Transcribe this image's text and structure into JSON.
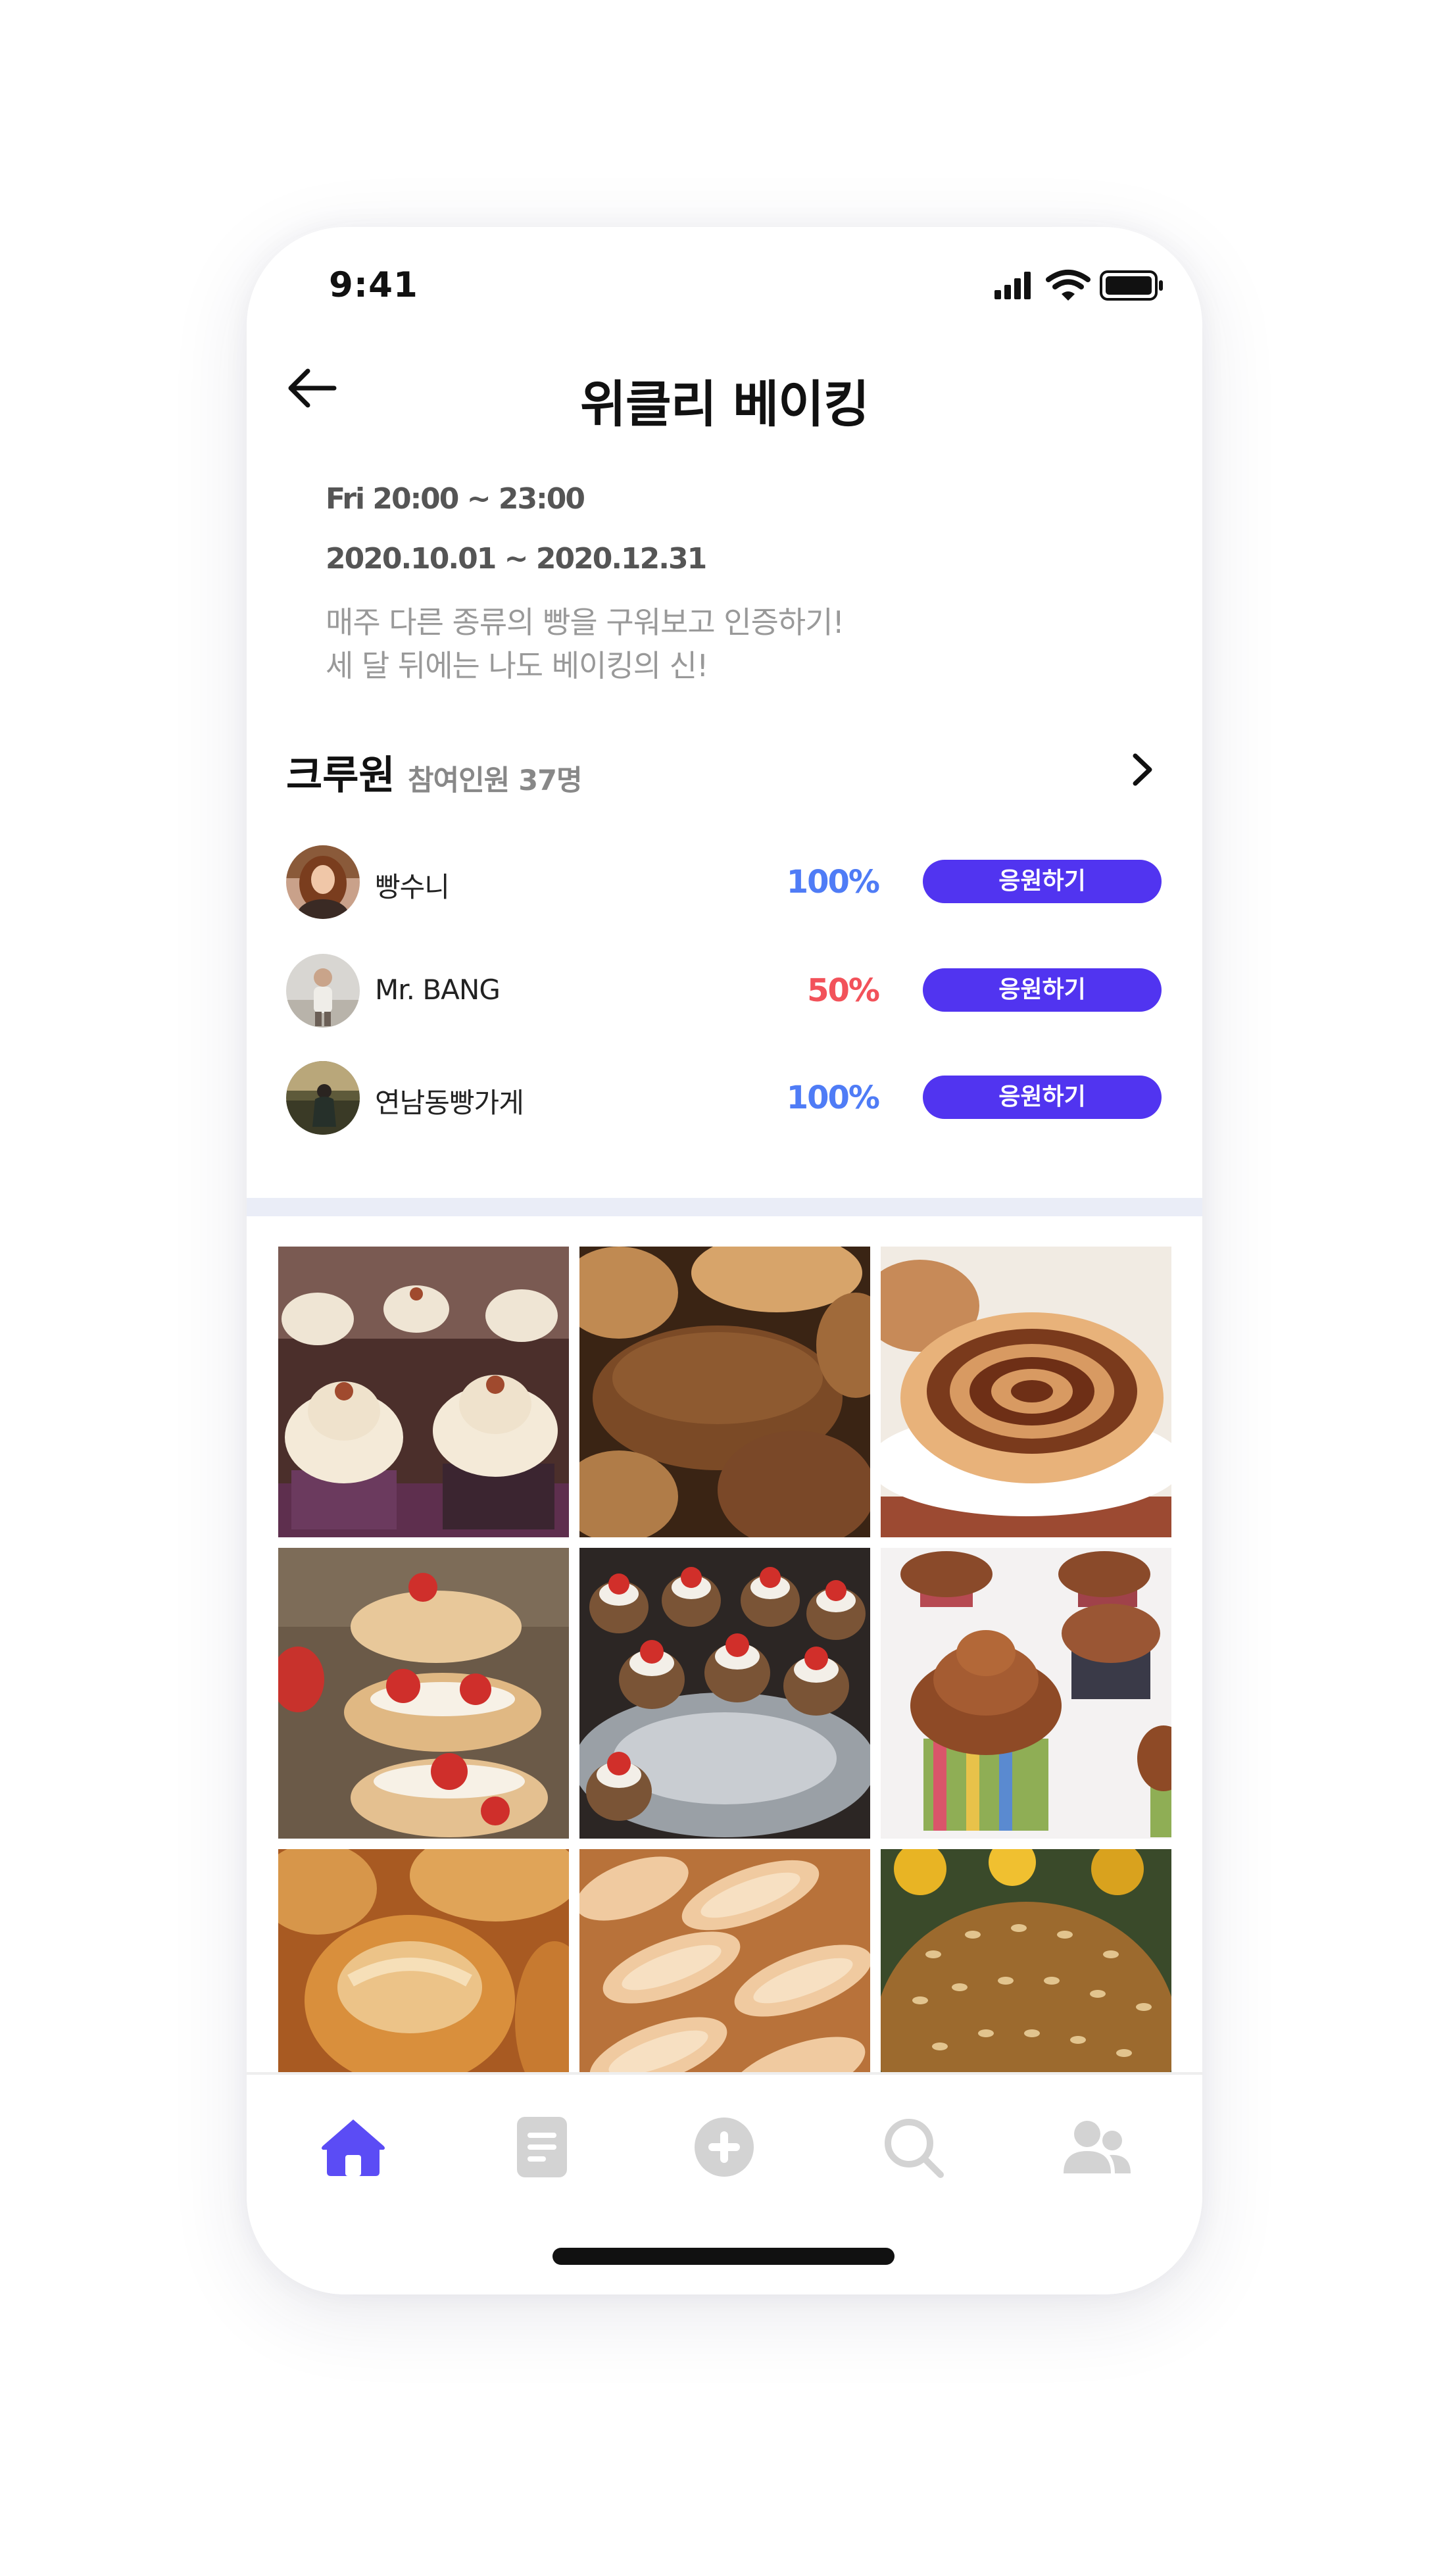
{
  "status_bar": {
    "time": "9:41"
  },
  "header": {
    "title": "위클리 베이킹"
  },
  "info": {
    "schedule": "Fri 20:00 ~ 23:00",
    "period": "2020.10.01 ~ 2020.12.31",
    "description_line1": "매주 다른 종류의 빵을 구워보고 인증하기!",
    "description_line2": "세 달 뒤에는 나도 베이킹의 신!"
  },
  "crew": {
    "title": "크루원",
    "count_text": "참여인원 37명",
    "members": [
      {
        "name": "빵수니",
        "percent": "100%",
        "button": "응원하기"
      },
      {
        "name": "Mr. BANG",
        "percent": "50%",
        "button": "응원하기"
      },
      {
        "name": "연남동빵가게",
        "percent": "100%",
        "button": "응원하기"
      }
    ]
  },
  "colors": {
    "accent": "#5134f0",
    "percent_full": "#4f7cf6",
    "percent_half": "#f2525a",
    "tab_active": "#5b4cf5",
    "tab_inactive": "#d3d3d3"
  },
  "gallery": {
    "photos": [
      "cupcakes-cream-icon",
      "rye-bread-icon",
      "cinnamon-roll-icon",
      "strawberry-eclair-icon",
      "strawberry-tarts-icon",
      "chocolate-cupcakes-icon",
      "baguette-rolls-icon",
      "sliced-bread-icon",
      "seed-bread-icon"
    ]
  },
  "tabbar": {
    "tabs": [
      "home-icon",
      "document-icon",
      "plus-circle-icon",
      "search-icon",
      "people-icon"
    ],
    "active": "home-icon"
  }
}
